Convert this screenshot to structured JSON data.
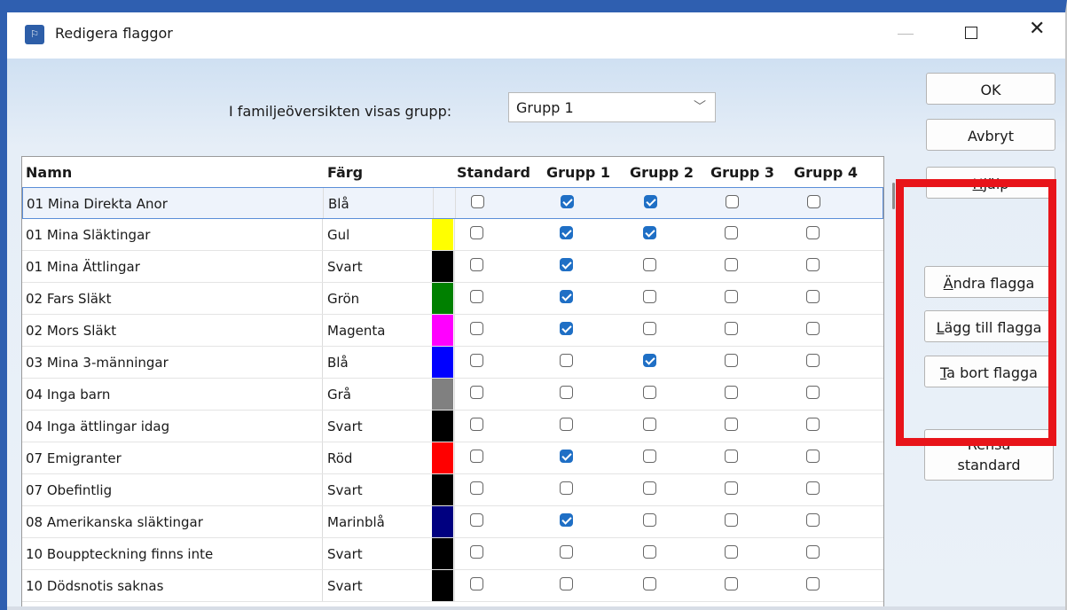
{
  "window": {
    "title": "Redigera flaggor",
    "icon": "app-flags-icon"
  },
  "group_selector": {
    "label": "I familjeöversikten visas grupp:",
    "value": "Grupp 1"
  },
  "table": {
    "columns": [
      "Namn",
      "Färg",
      "Standard",
      "Grupp 1",
      "Grupp 2",
      "Grupp 3",
      "Grupp 4"
    ],
    "rows": [
      {
        "name": "01 Mina Direkta Anor",
        "color": "Blå",
        "hex": "",
        "std": false,
        "g1": true,
        "g2": true,
        "g3": false,
        "g4": false,
        "selected": true
      },
      {
        "name": "01 Mina Släktingar",
        "color": "Gul",
        "hex": "#ffff00",
        "std": false,
        "g1": true,
        "g2": true,
        "g3": false,
        "g4": false
      },
      {
        "name": "01 Mina Ättlingar",
        "color": "Svart",
        "hex": "#000000",
        "std": false,
        "g1": true,
        "g2": false,
        "g3": false,
        "g4": false
      },
      {
        "name": "02 Fars Släkt",
        "color": "Grön",
        "hex": "#008000",
        "std": false,
        "g1": true,
        "g2": false,
        "g3": false,
        "g4": false
      },
      {
        "name": "02 Mors Släkt",
        "color": "Magenta",
        "hex": "#ff00ff",
        "std": false,
        "g1": true,
        "g2": false,
        "g3": false,
        "g4": false
      },
      {
        "name": "03 Mina 3-männingar",
        "color": "Blå",
        "hex": "#0000ff",
        "std": false,
        "g1": false,
        "g2": true,
        "g3": false,
        "g4": false
      },
      {
        "name": "04 Inga barn",
        "color": "Grå",
        "hex": "#808080",
        "std": false,
        "g1": false,
        "g2": false,
        "g3": false,
        "g4": false
      },
      {
        "name": "04 Inga ättlingar idag",
        "color": "Svart",
        "hex": "#000000",
        "std": false,
        "g1": false,
        "g2": false,
        "g3": false,
        "g4": false
      },
      {
        "name": "07 Emigranter",
        "color": "Röd",
        "hex": "#ff0000",
        "std": false,
        "g1": true,
        "g2": false,
        "g3": false,
        "g4": false
      },
      {
        "name": "07 Obefintlig",
        "color": "Svart",
        "hex": "#000000",
        "std": false,
        "g1": false,
        "g2": false,
        "g3": false,
        "g4": false
      },
      {
        "name": "08 Amerikanska släktingar",
        "color": "Marinblå",
        "hex": "#000080",
        "std": false,
        "g1": true,
        "g2": false,
        "g3": false,
        "g4": false
      },
      {
        "name": "10 Bouppteckning finns inte",
        "color": "Svart",
        "hex": "#000000",
        "std": false,
        "g1": false,
        "g2": false,
        "g3": false,
        "g4": false
      },
      {
        "name": "10 Dödsnotis saknas",
        "color": "Svart",
        "hex": "#000000",
        "std": false,
        "g1": false,
        "g2": false,
        "g3": false,
        "g4": false
      }
    ]
  },
  "buttons": {
    "ok": "OK",
    "cancel": "Avbryt",
    "help": {
      "underlined": "H",
      "rest": "jälp"
    },
    "edit": {
      "underlined": "Ä",
      "rest": "ndra flagga"
    },
    "add": {
      "underlined": "L",
      "rest": "ägg till flagga"
    },
    "remove": {
      "underlined": "T",
      "rest": "a bort flagga"
    },
    "clear_line1": "Rensa",
    "clear_line2": "standard"
  },
  "colors": {
    "highlight": "#e8141a",
    "accent": "#1f6fc5",
    "frame": "#2f5fb0"
  }
}
